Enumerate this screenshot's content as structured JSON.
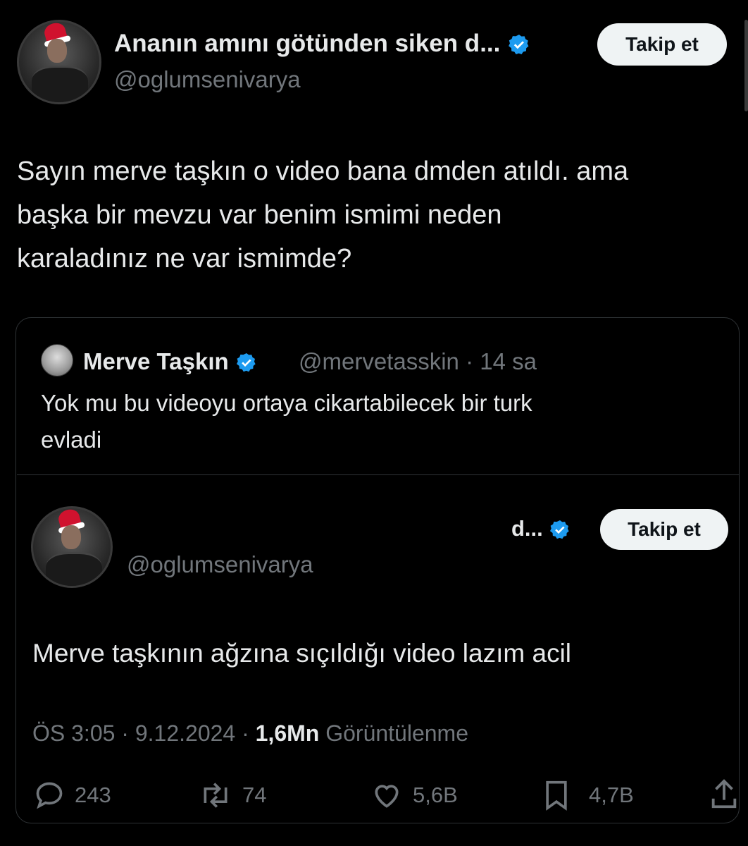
{
  "main_tweet": {
    "name": "Ananın amını götünden siken d...",
    "handle": "@oglumsenivarya",
    "follow_label": "Takip et",
    "text_lines": [
      "Sayın merve taşkın o video bana dmden atıldı. ama",
      "başka bir mevzu var benim ismimi neden",
      "karaladınız ne var ismimde?"
    ]
  },
  "quoted_tweet": {
    "name": "Merve Taşkın",
    "handle": "@mervetasskin",
    "time": "· 14 sa",
    "text_lines": [
      "Yok mu bu videoyu ortaya cikartabilecek bir turk",
      "evladi"
    ]
  },
  "embedded_tweet": {
    "name_truncated": "d...",
    "handle": "@oglumsenivarya",
    "follow_label": "Takip et",
    "text": "Merve taşkının ağzına sıçıldığı video lazım acil",
    "time": "ÖS 3:05",
    "date": "· 9.12.2024 ·",
    "views_count": "1,6Mn",
    "views_label": "Görüntülenme",
    "stats": {
      "replies": "243",
      "reposts": "74",
      "likes": "5,6B",
      "bookmarks": "4,7B"
    }
  },
  "colors": {
    "background": "#000000",
    "text": "#e7e9ea",
    "muted": "#71767b",
    "verified": "#1d9bf0",
    "border": "#2f3336",
    "button_bg": "#eff3f4"
  },
  "icons": [
    "verified-badge-icon",
    "reply-icon",
    "repost-icon",
    "like-icon",
    "bookmark-icon",
    "share-icon"
  ]
}
